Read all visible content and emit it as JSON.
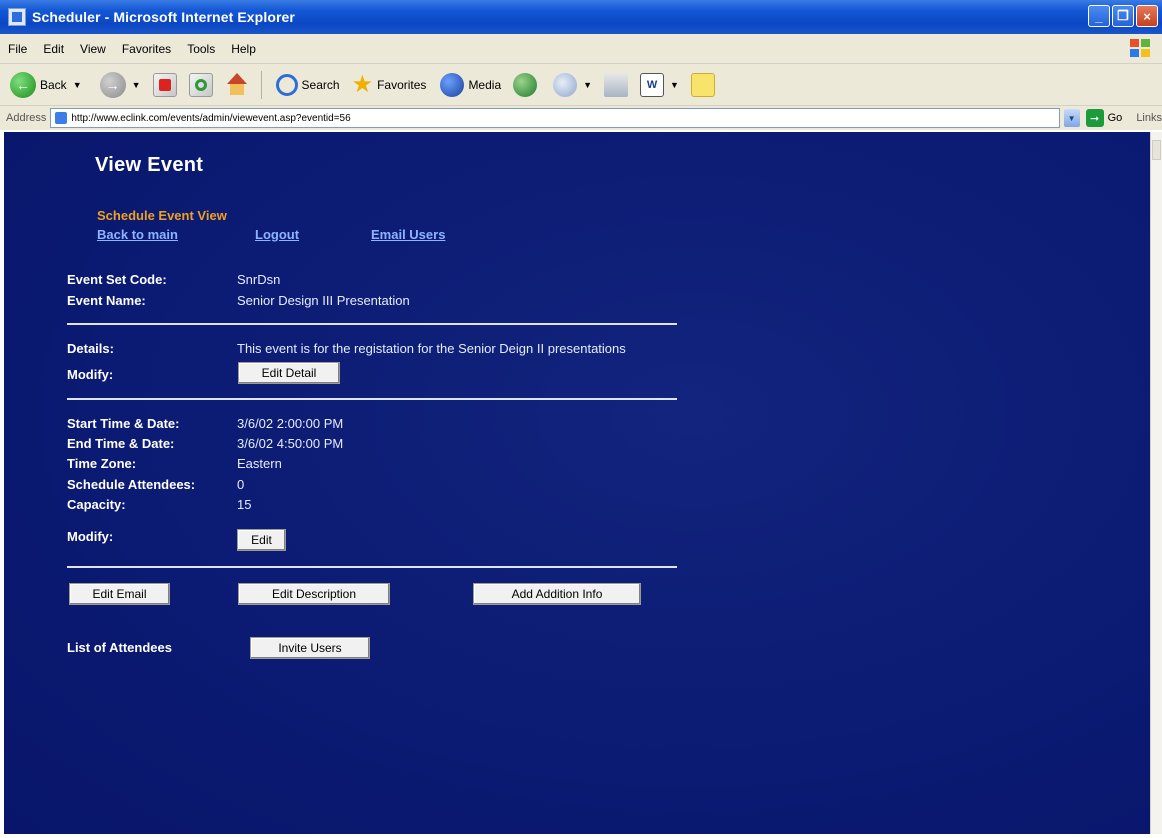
{
  "window": {
    "title": "Scheduler - Microsoft Internet Explorer",
    "minimize": "_",
    "maximize": "❐",
    "close": "×"
  },
  "menu": [
    "File",
    "Edit",
    "View",
    "Favorites",
    "Tools",
    "Help"
  ],
  "toolbar": {
    "back_label": "Back",
    "search_label": "Search",
    "favorites_label": "Favorites",
    "media_label": "Media"
  },
  "address": {
    "label": "Address",
    "url": "http://www.eclink.com/events/admin/viewevent.asp?eventid=56",
    "go_label": "Go",
    "links_label": "Links"
  },
  "page": {
    "title": "View Event",
    "subtitle": "Schedule Event View",
    "nav": {
      "back": "Back to main",
      "logout": "Logout",
      "email": "Email Users"
    },
    "event_set_code": {
      "label": "Event Set Code:",
      "value": "SnrDsn"
    },
    "event_name": {
      "label": "Event Name:",
      "value": "Senior Design III Presentation"
    },
    "details": {
      "label": "Details:",
      "value": "This event is for the registation for the Senior Deign II presentations"
    },
    "modify_detail": {
      "label": "Modify:",
      "button": "Edit Detail"
    },
    "start": {
      "label": "Start Time & Date:",
      "value": "3/6/02 2:00:00 PM"
    },
    "end": {
      "label": "End Time & Date:",
      "value": "3/6/02 4:50:00 PM"
    },
    "timezone": {
      "label": "Time Zone:",
      "value": "Eastern"
    },
    "attendees": {
      "label": "Schedule Attendees:",
      "value": "0"
    },
    "capacity": {
      "label": "Capacity:",
      "value": "15"
    },
    "modify_time": {
      "label": "Modify:",
      "button": "Edit"
    },
    "actions": {
      "edit_email": "Edit Email",
      "edit_description": "Edit Description",
      "add_info": "Add Addition Info"
    },
    "list_attendees": "List of Attendees",
    "invite_users": "Invite Users"
  }
}
